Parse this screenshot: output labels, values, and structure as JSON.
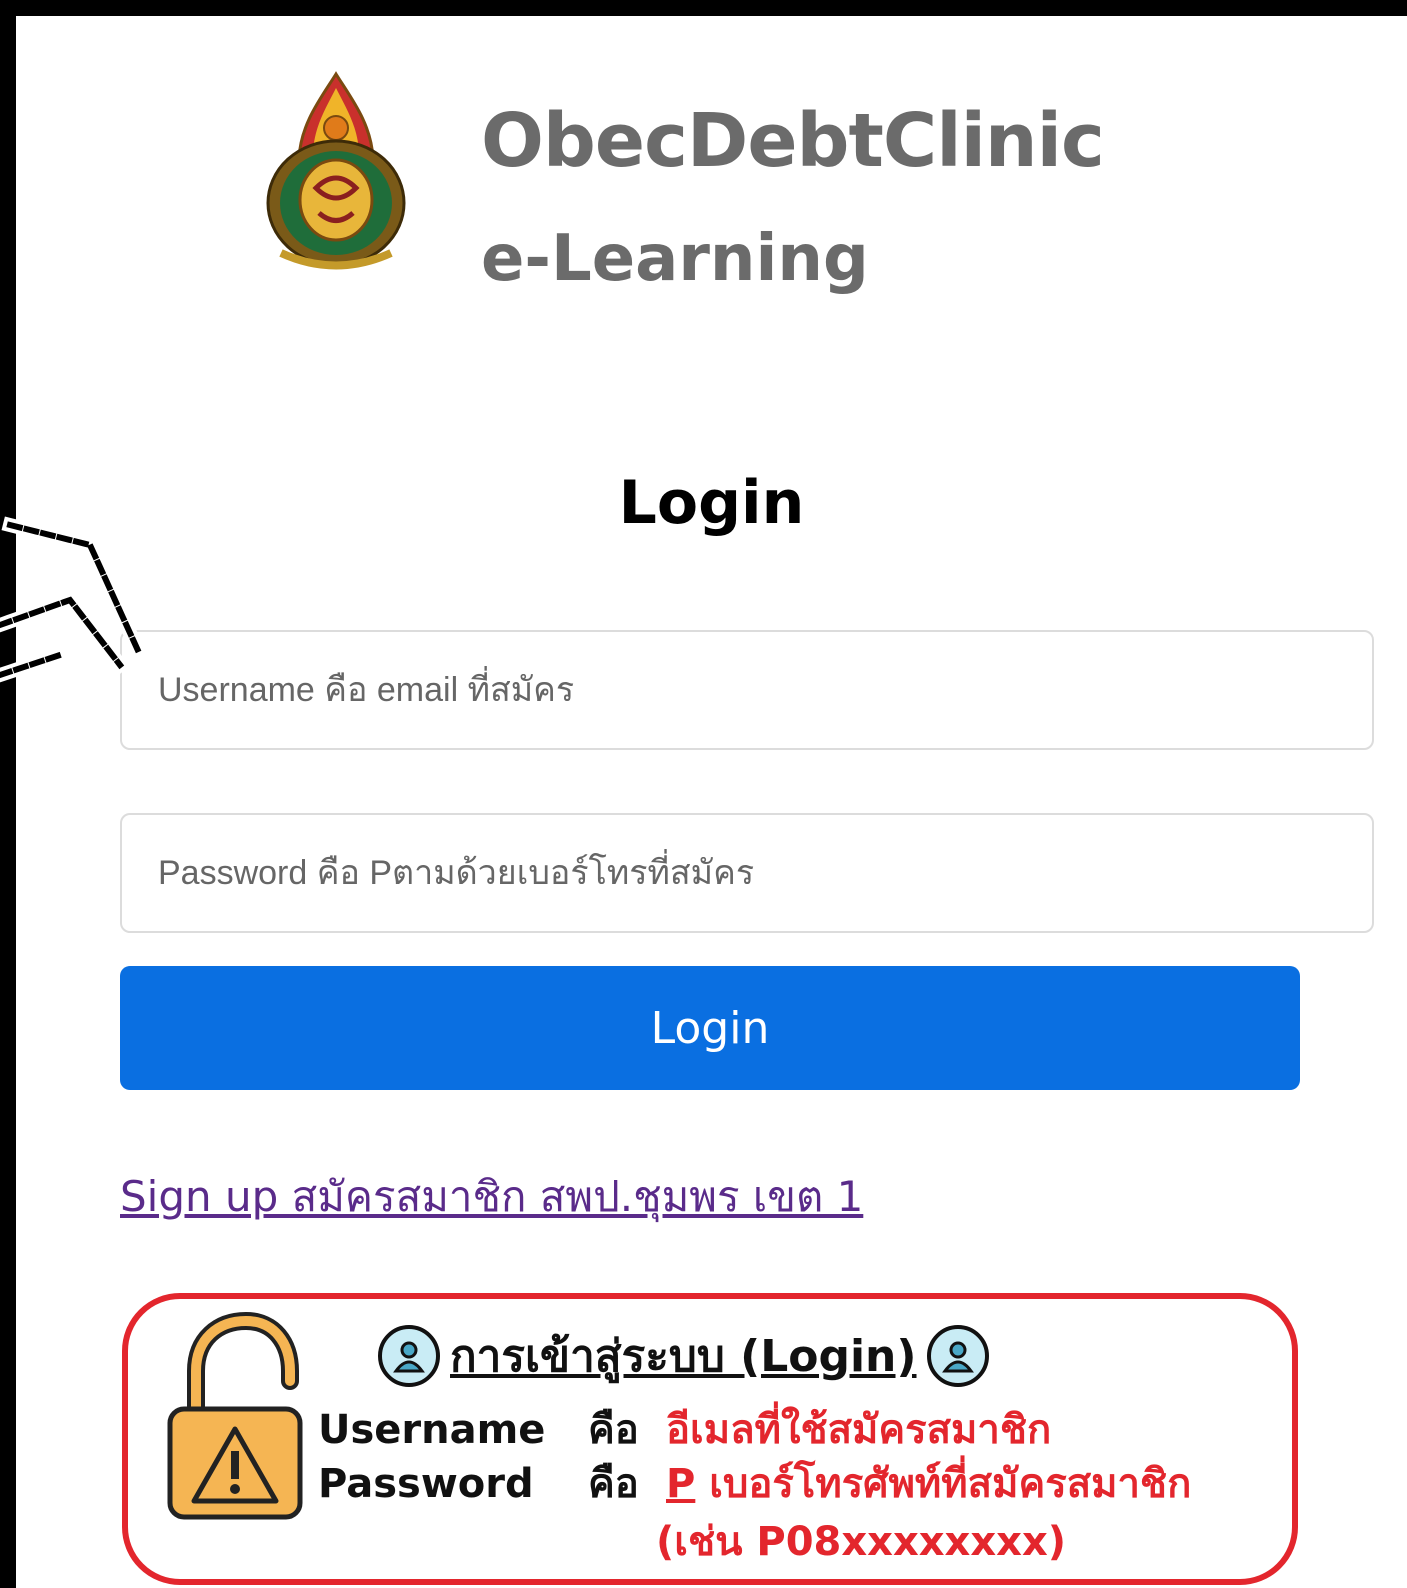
{
  "brand": {
    "title": "ObecDebtClinic",
    "subtitle": "e-Learning",
    "logo_icon": "obec-emblem-icon"
  },
  "form": {
    "heading": "Login",
    "username_placeholder": "Username คือ email ที่สมัคร",
    "password_placeholder": "Password คือ Pตามด้วยเบอร์โทรที่สมัคร",
    "login_button": "Login",
    "signup_link": "Sign up สมัครสมาชิก สพป.ชุมพร เขต 1"
  },
  "info": {
    "title": "การเข้าสู่ระบบ (Login)",
    "username_label": "Username",
    "is_label": "คือ",
    "username_value": "อีเมลที่ใช้สมัครสมาชิก",
    "password_label": "Password",
    "password_prefix": "P",
    "password_value": "เบอร์โทรศัพท์ที่สมัครสมาชิก",
    "password_example": "(เช่น P08xxxxxxxx)",
    "colors": {
      "border": "#e3262d",
      "highlight": "#e3262d"
    }
  },
  "colors": {
    "primary": "#0a6fe1",
    "link": "#5a2b8a",
    "brand_text": "#6b6b6b"
  }
}
